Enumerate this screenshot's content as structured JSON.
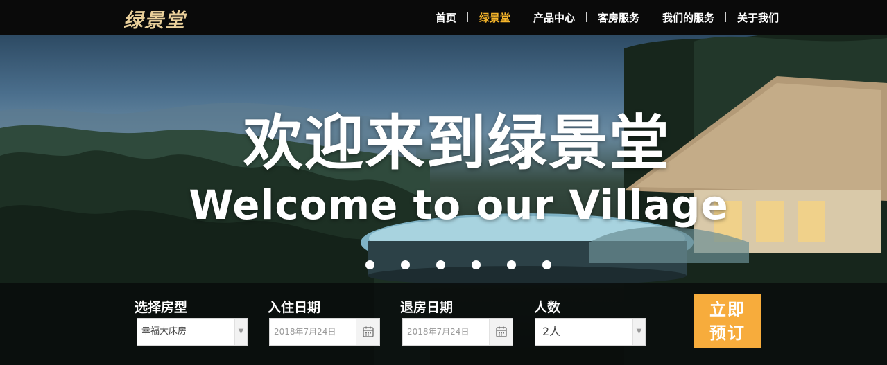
{
  "brand": {
    "logo_text": "绿景堂"
  },
  "nav": {
    "items": [
      {
        "label": "首页",
        "active": false
      },
      {
        "label": "绿景堂",
        "active": true
      },
      {
        "label": "产品中心",
        "active": false
      },
      {
        "label": "客房服务",
        "active": false
      },
      {
        "label": "我们的服务",
        "active": false
      },
      {
        "label": "关于我们",
        "active": false
      }
    ]
  },
  "hero": {
    "title": "欢迎来到绿景堂",
    "subtitle": "Welcome to our Village",
    "slide_count": 6
  },
  "booking": {
    "room_type": {
      "label": "选择房型",
      "value": "幸福大床房"
    },
    "checkin": {
      "label": "入住日期",
      "value": "2018年7月24日"
    },
    "checkout": {
      "label": "退房日期",
      "value": "2018年7月24日"
    },
    "guests": {
      "label": "人数",
      "value": "2人"
    },
    "submit": {
      "line1": "立即",
      "line2": "预订"
    }
  },
  "colors": {
    "accent": "#f5b52a",
    "button": "#f7ac3c",
    "logo": "#e9cf9a"
  }
}
